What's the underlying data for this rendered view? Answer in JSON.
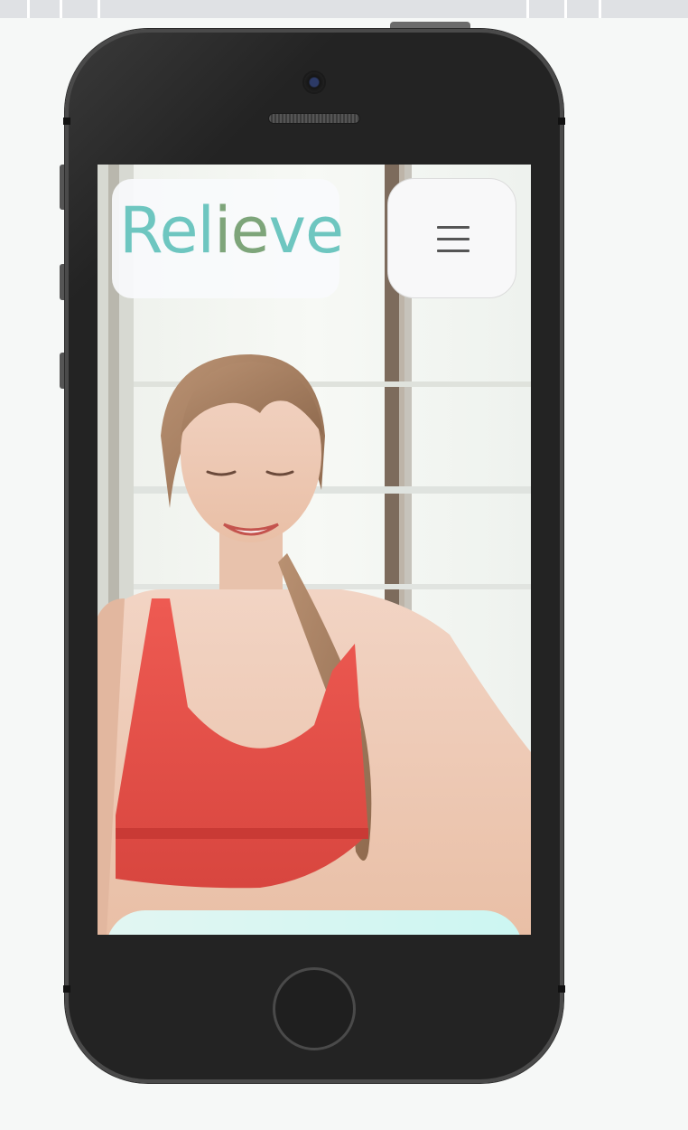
{
  "browser": {
    "tab_separators": 8
  },
  "app": {
    "logo": {
      "part1": "Rel",
      "part2": "ie",
      "part3": "ve",
      "primary_color": "#6ec6c0",
      "accent_color": "#7ea57a"
    },
    "menu_button": {
      "icon": "hamburger-menu-icon"
    },
    "hero_image": {
      "description_icon": "hero-photo"
    },
    "bottom_card": {
      "color": "#ccf6f2"
    }
  }
}
